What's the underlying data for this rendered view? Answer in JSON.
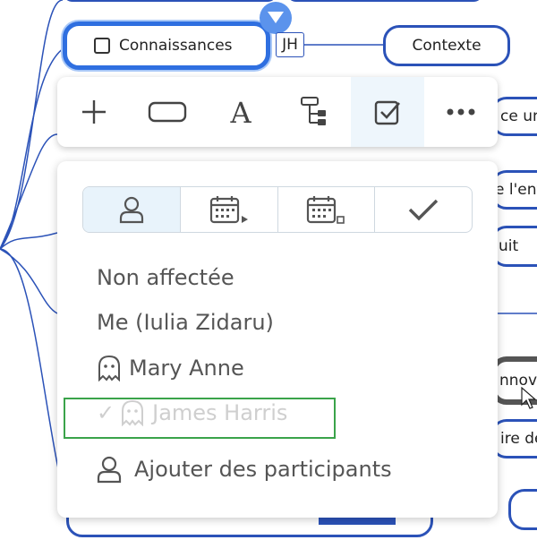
{
  "topic": {
    "label": "Connaissances",
    "assignee_badge": "JH"
  },
  "context_node": {
    "label": "Contexte"
  },
  "right_fragments": [
    "ce un",
    "e l'ent",
    "uit",
    "nnova",
    "ire de"
  ],
  "toolbar": {
    "items": [
      {
        "name": "add",
        "icon": "plus-icon"
      },
      {
        "name": "shape",
        "icon": "rectangle-shape-icon"
      },
      {
        "name": "text-style",
        "icon": "text-format-icon"
      },
      {
        "name": "layout",
        "icon": "tree-layout-icon"
      },
      {
        "name": "task",
        "icon": "task-checkbox-icon",
        "active": true
      },
      {
        "name": "more",
        "icon": "more-dots-icon"
      }
    ]
  },
  "task_panel": {
    "tabs": [
      {
        "name": "assignee",
        "icon": "person-icon",
        "active": true
      },
      {
        "name": "start-date",
        "icon": "calendar-start-icon"
      },
      {
        "name": "due-date",
        "icon": "calendar-end-icon"
      },
      {
        "name": "complete",
        "icon": "checkmark-icon"
      }
    ],
    "options": [
      {
        "label": "Non affectée"
      },
      {
        "label": "Me (Iulia Zidaru)"
      },
      {
        "label": "Mary Anne",
        "icon": "ghost-avatar-icon"
      },
      {
        "label": "James Harris",
        "icon": "ghost-avatar-icon",
        "checked_mark": "✓",
        "selected": true
      }
    ],
    "add_participants": {
      "label": "Ajouter des participants",
      "icon": "person-icon"
    }
  }
}
